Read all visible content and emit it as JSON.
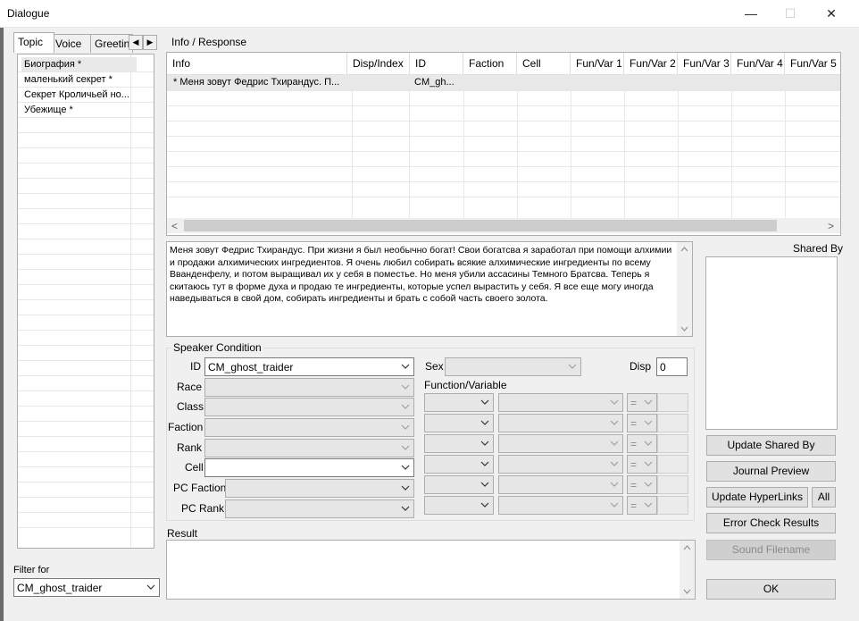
{
  "window": {
    "title": "Dialogue",
    "minimize": "—",
    "maximize": "☐",
    "close": "✕"
  },
  "left_tabs": {
    "items": [
      "Topic",
      "Voice",
      "Greetin"
    ],
    "scroll_left": "◀",
    "scroll_right": "▶"
  },
  "topics": [
    "Биография *",
    "маленький секрет *",
    "Секрет Кроличьей но...",
    "Убежище *"
  ],
  "filter": {
    "label": "Filter for",
    "value": "CM_ghost_traider"
  },
  "info_response": {
    "label": "Info / Response",
    "columns": [
      "Info",
      "Disp/Index",
      "ID",
      "Faction",
      "Cell",
      "Fun/Var 1",
      "Fun/Var 2",
      "Fun/Var 3",
      "Fun/Var 4",
      "Fun/Var 5"
    ],
    "rows": [
      {
        "info": "* Меня зовут Федрис Тхирандус. П...",
        "disp": "",
        "id": "CM_gh...",
        "faction": "",
        "cell": ""
      }
    ],
    "scroll_left": "<",
    "scroll_right": ">"
  },
  "response_text": "Меня зовут Федрис Тхирандус. При жизни я был необычно богат! Свои богатсва я заработал при помощи алхимии и продажи алхимических ингредиентов. Я очень любил собирать всякие алхимические ингредиенты по всему Вванденфелу, и потом выращивал их у себя в поместье. Но меня убили  ассасины Темного Братсва. Теперь я скитаюсь тут в форме духа и продаю те ингредиенты, которые успел вырастить у себя. Я все еще могу иногда наведываться в свой дом, собирать ингредиенты и брать с собой часть своего золота.",
  "speaker": {
    "title": "Speaker Condition",
    "id_label": "ID",
    "id_value": "CM_ghost_traider",
    "race_label": "Race",
    "class_label": "Class",
    "faction_label": "Faction",
    "rank_label": "Rank",
    "cell_label": "Cell",
    "pc_faction_label": "PC Faction",
    "pc_rank_label": "PC Rank",
    "sex_label": "Sex",
    "disp_label": "Disp",
    "disp_value": "0",
    "funcvar_label": "Function/Variable",
    "operator": "="
  },
  "shared_by": {
    "label": "Shared By"
  },
  "buttons": {
    "update_shared": "Update Shared By",
    "journal_preview": "Journal Preview",
    "update_hyperlinks": "Update HyperLinks",
    "all": "All",
    "error_check": "Error Check Results",
    "sound_filename": "Sound Filename",
    "ok": "OK"
  },
  "result": {
    "label": "Result",
    "value": ""
  }
}
